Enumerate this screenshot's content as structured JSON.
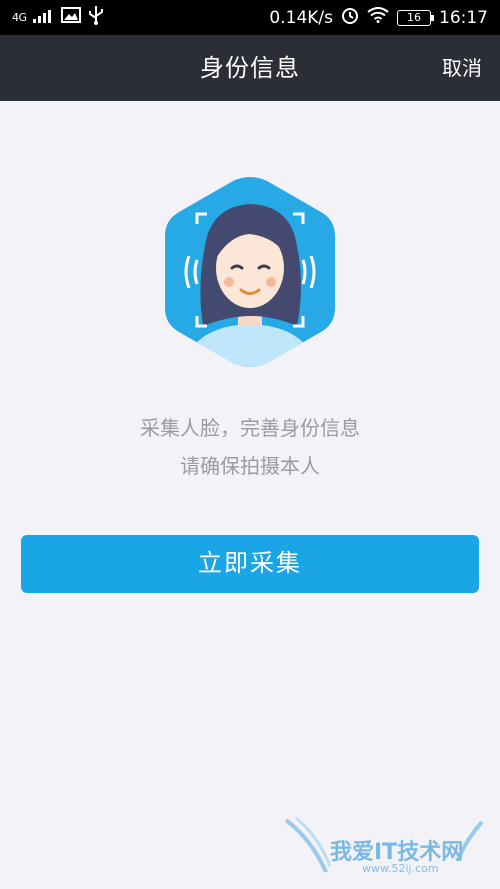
{
  "status_bar": {
    "network": "4G",
    "speed": "0.14K/s",
    "battery": "16",
    "time": "16:17"
  },
  "nav": {
    "title": "身份信息",
    "cancel_label": "取消"
  },
  "main": {
    "line1": "采集人脸，完善身份信息",
    "line2": "请确保拍摄本人",
    "capture_button": "立即采集"
  },
  "watermark": {
    "text": "我爱IT技术网",
    "url": "www.52ij.com"
  },
  "colors": {
    "accent": "#1aa6e6",
    "nav_bg": "#2b2e36",
    "page_bg": "#f3f3f7"
  }
}
